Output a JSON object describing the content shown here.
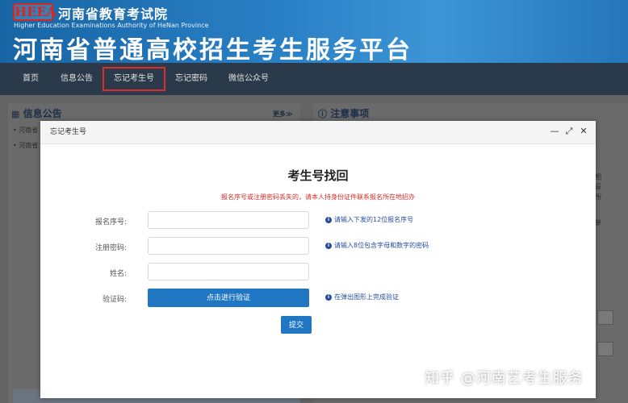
{
  "header": {
    "logo_text": "HEEA",
    "org_name": "河南省教育考试院",
    "org_name_en": "Higher Education Examinations Authority of HeNan Province",
    "platform_title": "河南省普通高校招生考生服务平台"
  },
  "nav": {
    "items": [
      {
        "label": "首页"
      },
      {
        "label": "信息公告"
      },
      {
        "label": "忘记考生号"
      },
      {
        "label": "忘记密码"
      },
      {
        "label": "微信公众号"
      }
    ]
  },
  "underlay": {
    "left_heading": "信息公告",
    "more": "更多≫",
    "left_items": [
      "河南省",
      "河南省"
    ],
    "right_heading": "注意事项",
    "right_fragments": [
      "相",
      "设",
      "所",
      "单"
    ]
  },
  "modal": {
    "title": "忘记考生号",
    "heading": "考生号找回",
    "notice": "报名序号或注册密码丢失的，请本人持身份证件联系报名所在地招办",
    "fields": [
      {
        "label": "报名序号:",
        "value": "",
        "hint": "请输入下发的12位报名序号"
      },
      {
        "label": "注册密码:",
        "value": "",
        "hint": "请输入8位包含字母和数字的密码"
      },
      {
        "label": "姓名:",
        "value": ""
      }
    ],
    "captcha": {
      "label": "验证码:",
      "button": "点击进行验证",
      "hint": "在弹出图形上完成验证"
    },
    "submit": "提交"
  },
  "watermark": "知乎 @河南艺考生服务"
}
